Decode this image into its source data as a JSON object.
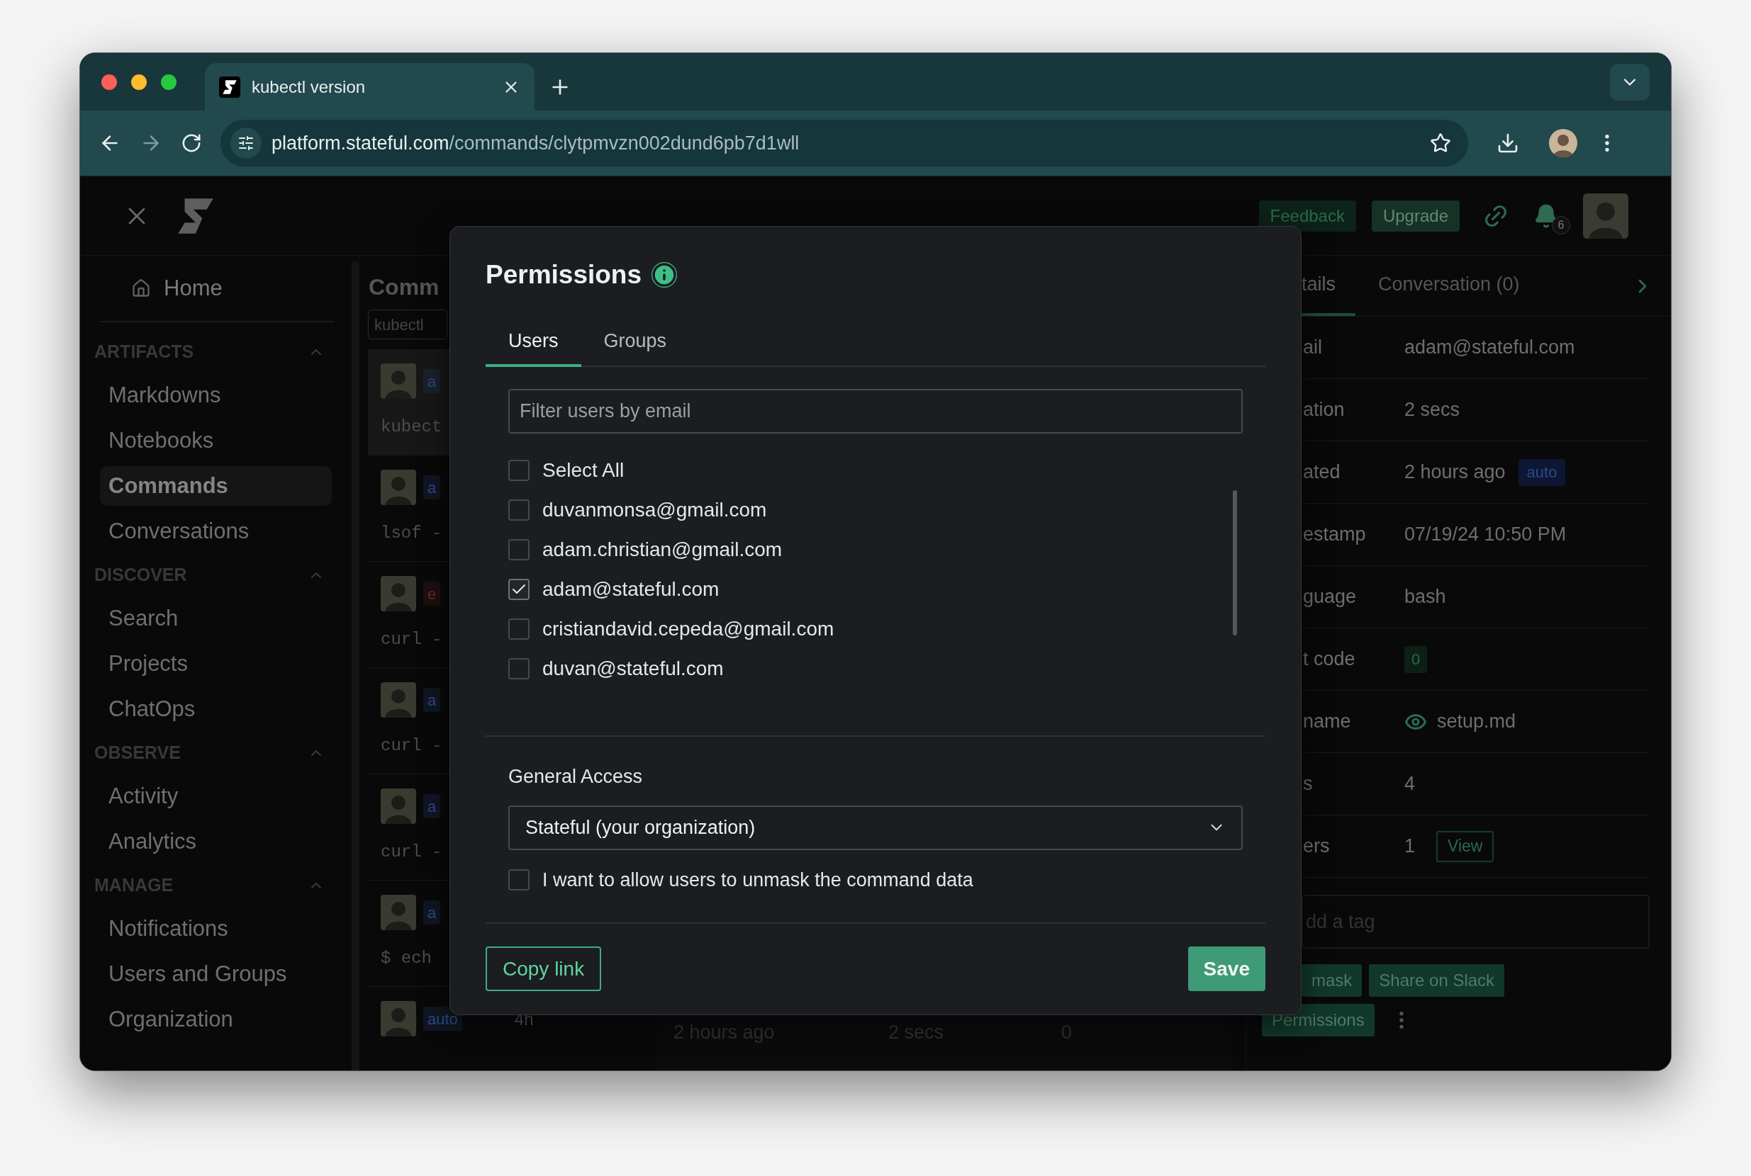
{
  "browser": {
    "tab_title": "kubectl version",
    "url_host": "platform.stateful.com",
    "url_path": "/commands/clytpmvzn002dund6pb7d1wll"
  },
  "header": {
    "buttons": [
      "Feedback",
      "Upgrade"
    ],
    "notification_count": "6"
  },
  "sidebar": {
    "home": "Home",
    "sections": [
      {
        "title": "ARTIFACTS",
        "expanded": true,
        "items": [
          {
            "label": "Markdowns",
            "selected": false
          },
          {
            "label": "Notebooks",
            "selected": false
          },
          {
            "label": "Commands",
            "selected": true
          },
          {
            "label": "Conversations",
            "selected": false
          }
        ]
      },
      {
        "title": "DISCOVER",
        "expanded": true,
        "items": [
          {
            "label": "Search",
            "selected": false
          },
          {
            "label": "Projects",
            "selected": false
          },
          {
            "label": "ChatOps",
            "selected": false
          }
        ]
      },
      {
        "title": "OBSERVE",
        "expanded": true,
        "items": [
          {
            "label": "Activity",
            "selected": false
          },
          {
            "label": "Analytics",
            "selected": false
          }
        ]
      },
      {
        "title": "MANAGE",
        "expanded": true,
        "items": [
          {
            "label": "Notifications",
            "selected": false
          },
          {
            "label": "Users and Groups",
            "selected": false
          },
          {
            "label": "Organization",
            "selected": false
          }
        ]
      }
    ]
  },
  "command_list": {
    "title": "Comm",
    "search_value": "kubectl",
    "items": [
      {
        "badge": "a",
        "color": "#2c4a86",
        "command": "kubect",
        "selected": true
      },
      {
        "badge": "a",
        "color": "#2c4a86",
        "command": "lsof -",
        "selected": false
      },
      {
        "badge": "e",
        "color": "#6a2626",
        "command": "curl -",
        "selected": false
      },
      {
        "badge": "a",
        "color": "#2c4a86",
        "command": "curl -",
        "selected": false
      },
      {
        "badge": "a",
        "color": "#2c4a86",
        "command": "curl -",
        "selected": false
      },
      {
        "badge": "a",
        "color": "#2c4a86",
        "command": "$ ech",
        "selected": false
      },
      {
        "badge": "auto",
        "color": "#2c4a86",
        "time": "4h",
        "selected": false
      }
    ]
  },
  "main_row": {
    "cells": [
      "2 hours ago",
      "2 secs",
      "0"
    ]
  },
  "details": {
    "tabs": [
      {
        "label": "tails",
        "selected": true
      },
      {
        "label": "Conversation (0)",
        "selected": false
      }
    ],
    "rows": [
      {
        "kind": "text",
        "label": "ail",
        "value": "adam@stateful.com"
      },
      {
        "kind": "text",
        "label": "ation",
        "value": "2 secs"
      },
      {
        "kind": "badge",
        "label": "ated",
        "value": "2 hours ago",
        "badge": "auto"
      },
      {
        "kind": "text",
        "label": "estamp",
        "value": "07/19/24 10:50 PM"
      },
      {
        "kind": "text",
        "label": "guage",
        "value": "bash"
      },
      {
        "kind": "code",
        "label": "t code",
        "value": "0"
      },
      {
        "kind": "file",
        "label": "name",
        "value": "setup.md"
      },
      {
        "kind": "text",
        "label": "s",
        "value": "4"
      },
      {
        "kind": "action",
        "label": "ers",
        "value": "1",
        "action": "View"
      }
    ],
    "tag_placeholder": "dd a tag",
    "actions": [
      "mask",
      "Share on Slack"
    ],
    "permissions_button": "Permissions"
  },
  "modal": {
    "title": "Permissions",
    "tabs": [
      {
        "label": "Users",
        "selected": true
      },
      {
        "label": "Groups",
        "selected": false
      }
    ],
    "filter_placeholder": "Filter users by email",
    "users": [
      {
        "label": "Select All",
        "checked": false
      },
      {
        "label": "duvanmonsa@gmail.com",
        "checked": false
      },
      {
        "label": "adam.christian@gmail.com",
        "checked": false
      },
      {
        "label": "adam@stateful.com",
        "checked": true
      },
      {
        "label": "cristiandavid.cepeda@gmail.com",
        "checked": false
      },
      {
        "label": "duvan@stateful.com",
        "checked": false
      }
    ],
    "general_access": {
      "label": "General Access",
      "value": "Stateful (your organization)"
    },
    "unmask": {
      "label": "I want to allow users to unmask the command data",
      "checked": false
    },
    "copy_button": "Copy link",
    "save_button": "Save"
  }
}
